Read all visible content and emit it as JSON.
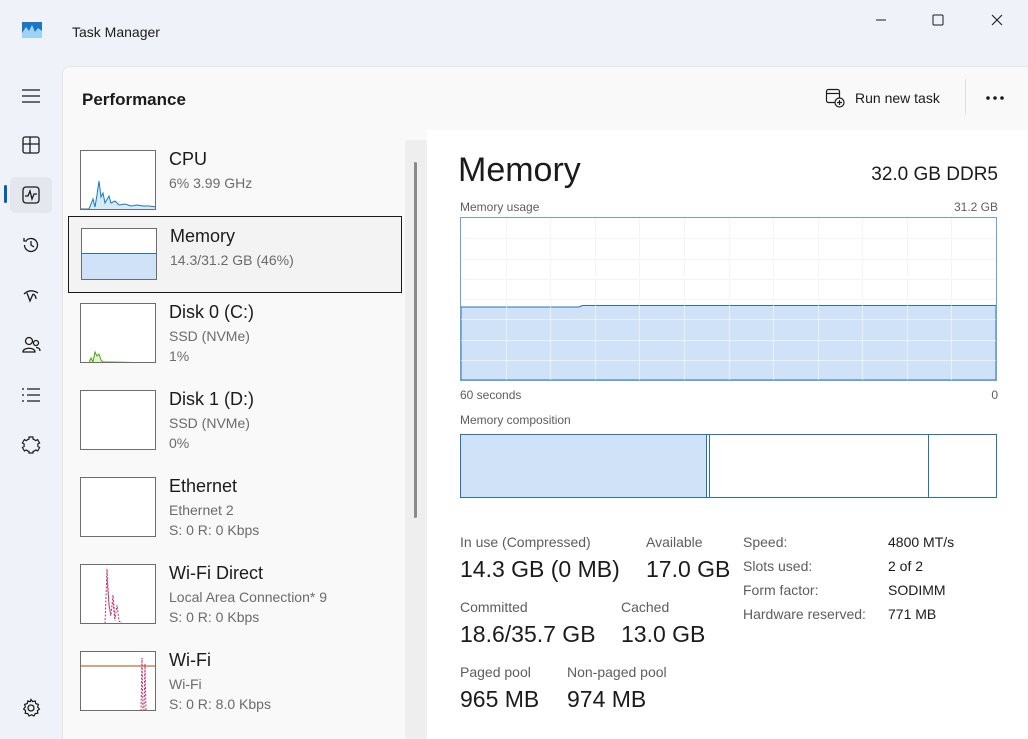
{
  "window": {
    "title": "Task Manager",
    "icon": "task-manager-icon",
    "controls": [
      "minimize-icon",
      "maximize-icon",
      "close-icon"
    ]
  },
  "nav": {
    "items": [
      {
        "icon": "hamburger-icon",
        "label": "Menu"
      },
      {
        "icon": "processes-icon",
        "label": "Processes"
      },
      {
        "icon": "performance-icon",
        "label": "Performance",
        "active": true
      },
      {
        "icon": "app-history-icon",
        "label": "App history"
      },
      {
        "icon": "startup-apps-icon",
        "label": "Startup apps"
      },
      {
        "icon": "users-icon",
        "label": "Users"
      },
      {
        "icon": "details-icon",
        "label": "Details"
      },
      {
        "icon": "services-icon",
        "label": "Services"
      },
      {
        "icon": "settings-icon",
        "label": "Settings"
      }
    ]
  },
  "header": {
    "title": "Performance",
    "run_task_label": "Run new task",
    "more_icon": "more-options-icon"
  },
  "list": {
    "items": [
      {
        "name": "CPU",
        "sub1": "6% 3.99 GHz",
        "sub2": ""
      },
      {
        "name": "Memory",
        "sub1": "14.3/31.2 GB (46%)",
        "sub2": "",
        "selected": true
      },
      {
        "name": "Disk 0 (C:)",
        "sub1": "SSD (NVMe)",
        "sub2": "1%"
      },
      {
        "name": "Disk 1 (D:)",
        "sub1": "SSD (NVMe)",
        "sub2": "0%"
      },
      {
        "name": "Ethernet",
        "sub1": "Ethernet 2",
        "sub2": "S: 0 R: 0 Kbps"
      },
      {
        "name": "Wi-Fi Direct",
        "sub1": "Local Area Connection* 9",
        "sub2": "S: 0 R: 0 Kbps"
      },
      {
        "name": "Wi-Fi",
        "sub1": "Wi-Fi",
        "sub2": "S: 0 R: 8.0 Kbps"
      }
    ]
  },
  "detail": {
    "title": "Memory",
    "spec": "32.0 GB DDR5",
    "usage_label": "Memory usage",
    "usage_max": "31.2 GB",
    "axis_left": "60 seconds",
    "axis_right": "0",
    "usage_fraction": 0.46,
    "composition_label": "Memory composition",
    "stats": {
      "in_use_label": "In use (Compressed)",
      "in_use_value": "14.3 GB (0 MB)",
      "available_label": "Available",
      "available_value": "17.0 GB",
      "committed_label": "Committed",
      "committed_value": "18.6/35.7 GB",
      "cached_label": "Cached",
      "cached_value": "13.0 GB",
      "paged_label": "Paged pool",
      "paged_value": "965 MB",
      "nonpaged_label": "Non-paged pool",
      "nonpaged_value": "974 MB"
    },
    "props": [
      {
        "key": "Speed:",
        "value": "4800 MT/s"
      },
      {
        "key": "Slots used:",
        "value": "2 of 2"
      },
      {
        "key": "Form factor:",
        "value": "SODIMM"
      },
      {
        "key": "Hardware reserved:",
        "value": "771 MB"
      }
    ]
  },
  "colors": {
    "accent": "#005fb8",
    "memory_fill": "#cfe2f8",
    "memory_line": "#2c6fb5",
    "cpu_line": "#117dbb",
    "disk_line": "#4da60c",
    "network_line": "#a74f01",
    "wifi_direct_line": "#c0306e"
  }
}
